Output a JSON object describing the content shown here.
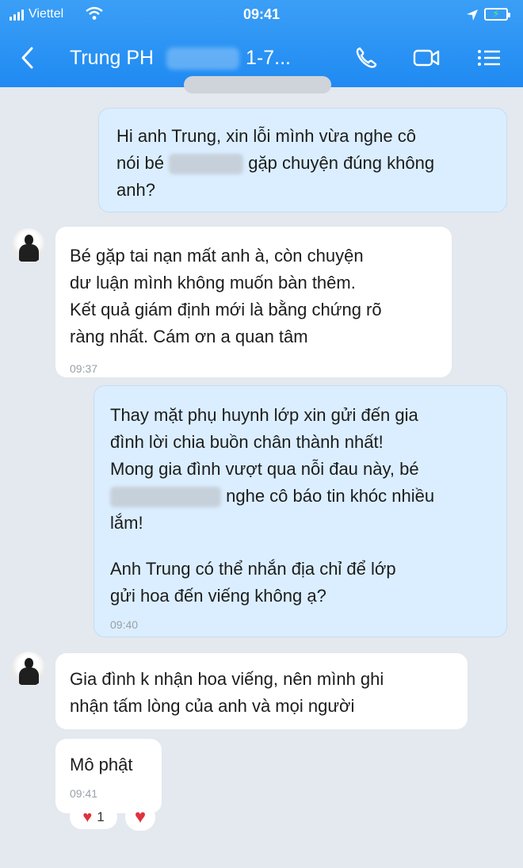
{
  "status_bar": {
    "carrier": "Viettel",
    "time": "09:41"
  },
  "header": {
    "name": "Trung PH",
    "name_suffix": "1-7..."
  },
  "messages": [
    {
      "from": "me",
      "lines": [
        "Hi anh Trung, xin lỗi mình vừa nghe cô",
        "nói bé",
        "gặp chuyện đúng không",
        "anh?"
      ]
    },
    {
      "from": "them",
      "lines": [
        "Bé gặp tai nạn mất anh à, còn chuyện",
        "dư luận mình không muốn bàn thêm.",
        "Kết quả giám định mới là bằng chứng rõ",
        "ràng nhất. Cám ơn a quan tâm"
      ],
      "time": "09:37"
    },
    {
      "from": "me",
      "lines": [
        "Thay mặt phụ huynh lớp xin gửi đến gia",
        "đình lời chia buồn chân thành nhất!",
        "Mong gia đình vượt qua nỗi đau này, bé",
        "nghe cô báo tin khóc nhiều",
        "lắm!",
        "Anh Trung có thể nhắn địa chỉ để lớp",
        "gửi hoa đến viếng không ạ?"
      ],
      "time": "09:40"
    },
    {
      "from": "them",
      "lines": [
        "Gia đình k nhận hoa viếng, nên mình ghi",
        "nhận tấm lòng của anh và mọi người"
      ]
    },
    {
      "from": "them",
      "lines": [
        "Mô phật"
      ],
      "time": "09:41",
      "reaction_count": "1"
    }
  ]
}
